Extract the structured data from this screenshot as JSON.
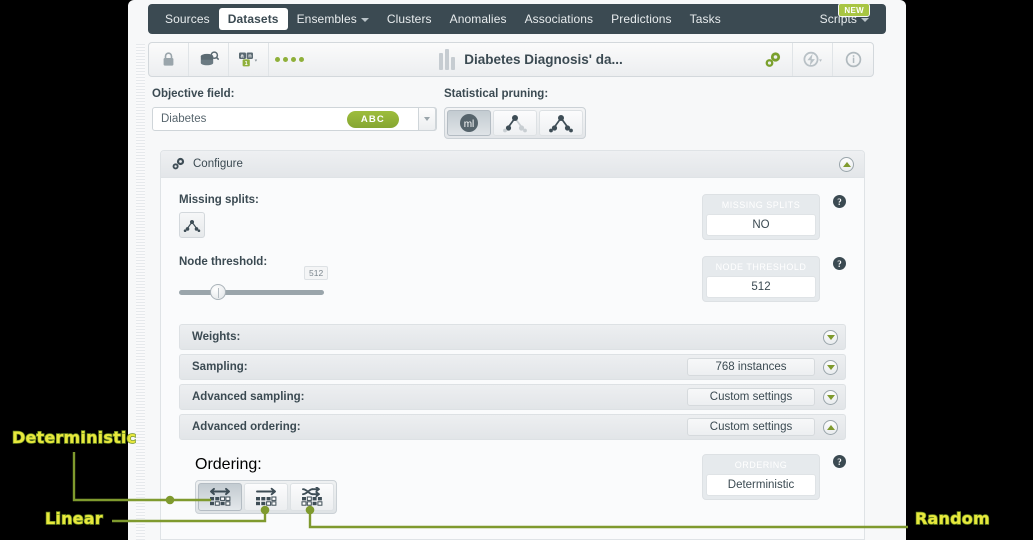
{
  "topnav": {
    "items": [
      {
        "label": "Sources",
        "active": false,
        "caret": false
      },
      {
        "label": "Datasets",
        "active": true,
        "caret": false
      },
      {
        "label": "Ensembles",
        "active": false,
        "caret": true
      },
      {
        "label": "Clusters",
        "active": false,
        "caret": false
      },
      {
        "label": "Anomalies",
        "active": false,
        "caret": false
      },
      {
        "label": "Associations",
        "active": false,
        "caret": false
      },
      {
        "label": "Predictions",
        "active": false,
        "caret": false
      },
      {
        "label": "Tasks",
        "active": false,
        "caret": false
      }
    ],
    "scripts": {
      "label": "Scripts",
      "badge": "NEW"
    }
  },
  "dataset_header": {
    "title": "Diabetes Diagnosis' da...",
    "left_icons": [
      "lock-icon",
      "dataset-search-icon",
      "dataset-fields-icon",
      "status-dots-icon"
    ],
    "right_icons": [
      "gears-icon",
      "lightning-icon",
      "info-icon"
    ]
  },
  "objective": {
    "label": "Objective field:",
    "value": "Diabetes",
    "type_badge": "ABC"
  },
  "pruning": {
    "label": "Statistical pruning:",
    "options": [
      "ml-pruning-icon",
      "partial-pruning-icon",
      "full-pruning-icon"
    ],
    "selected_index": 0
  },
  "configure": {
    "title": "Configure",
    "missing_splits": {
      "label": "Missing splits:",
      "chip_caption": "MISSING SPLITS",
      "chip_value": "NO",
      "help": "?"
    },
    "node_threshold": {
      "label": "Node threshold:",
      "slider_value": "512",
      "chip_caption": "NODE THRESHOLD",
      "chip_value": "512",
      "help": "?"
    },
    "rows": [
      {
        "label": "Weights:",
        "pill": "",
        "expanded": false
      },
      {
        "label": "Sampling:",
        "pill": "768 instances",
        "expanded": false
      },
      {
        "label": "Advanced sampling:",
        "pill": "Custom settings",
        "expanded": false
      },
      {
        "label": "Advanced ordering:",
        "pill": "Custom settings",
        "expanded": true
      }
    ],
    "ordering": {
      "label": "Ordering:",
      "buttons": [
        "deterministic-ordering-icon",
        "linear-ordering-icon",
        "random-ordering-icon"
      ],
      "selected_index": 0,
      "chip_caption": "ORDERING",
      "chip_value": "Deterministic",
      "help": "?"
    }
  },
  "annotations": [
    {
      "id": "deterministic",
      "text": "Deterministic"
    },
    {
      "id": "linear",
      "text": "Linear"
    },
    {
      "id": "random",
      "text": "Random"
    }
  ],
  "colors": {
    "accent_green": "#8fb03a",
    "nav_dark": "#3b4a52",
    "annotation_fill": "#e8e83c",
    "annotation_stroke": "#6f8f22"
  }
}
